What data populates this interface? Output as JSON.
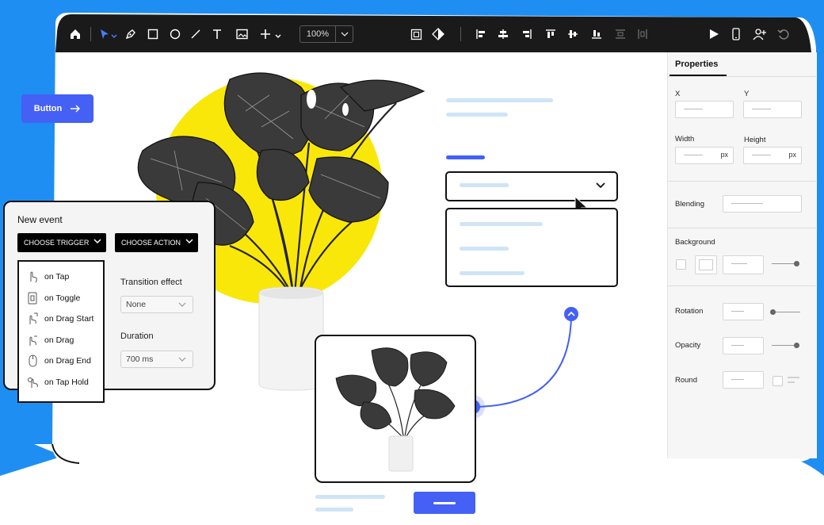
{
  "colors": {
    "accent": "#4460f5",
    "toolbar": "#1a1a1a",
    "backdrop": "#1f8ef2",
    "sun": "#f9e70a"
  },
  "toolbar": {
    "zoom": "100%",
    "left_icons": [
      "home-icon",
      "pointer-icon",
      "pen-icon",
      "rectangle-icon",
      "ellipse-icon",
      "line-icon",
      "text-icon",
      "image-icon",
      "plus-icon"
    ],
    "center_icons": [
      "component-icon",
      "mask-icon",
      "align-left-icon",
      "align-center-h-icon",
      "align-right-icon",
      "align-top-icon",
      "align-middle-icon",
      "align-bottom-icon",
      "distribute-v-icon",
      "distribute-h-icon"
    ],
    "right_icons": [
      "play-icon",
      "mobile-icon",
      "add-user-icon",
      "undo-icon"
    ]
  },
  "canvas": {
    "button_label": "Button"
  },
  "event": {
    "title": "New event",
    "trigger_label": "CHOOSE TRIGGER",
    "action_label": "CHOOSE ACTION",
    "triggers": [
      {
        "label": "on Tap",
        "icon": "tap-icon"
      },
      {
        "label": "on Toggle",
        "icon": "toggle-icon"
      },
      {
        "label": "on Drag Start",
        "icon": "drag-start-icon"
      },
      {
        "label": "on Drag",
        "icon": "drag-icon"
      },
      {
        "label": "on Drag End",
        "icon": "mouse-icon"
      },
      {
        "label": "on Tap Hold",
        "icon": "tap-hold-icon"
      }
    ],
    "transition_label": "Transition effect",
    "transition_value": "None",
    "duration_label": "Duration",
    "duration_value": "700 ms"
  },
  "properties": {
    "tab": "Properties",
    "x_label": "X",
    "y_label": "Y",
    "width_label": "Width",
    "height_label": "Height",
    "unit": "px",
    "blending_label": "Blending",
    "background_label": "Background",
    "rotation_label": "Rotation",
    "opacity_label": "Opacity",
    "round_label": "Round"
  }
}
